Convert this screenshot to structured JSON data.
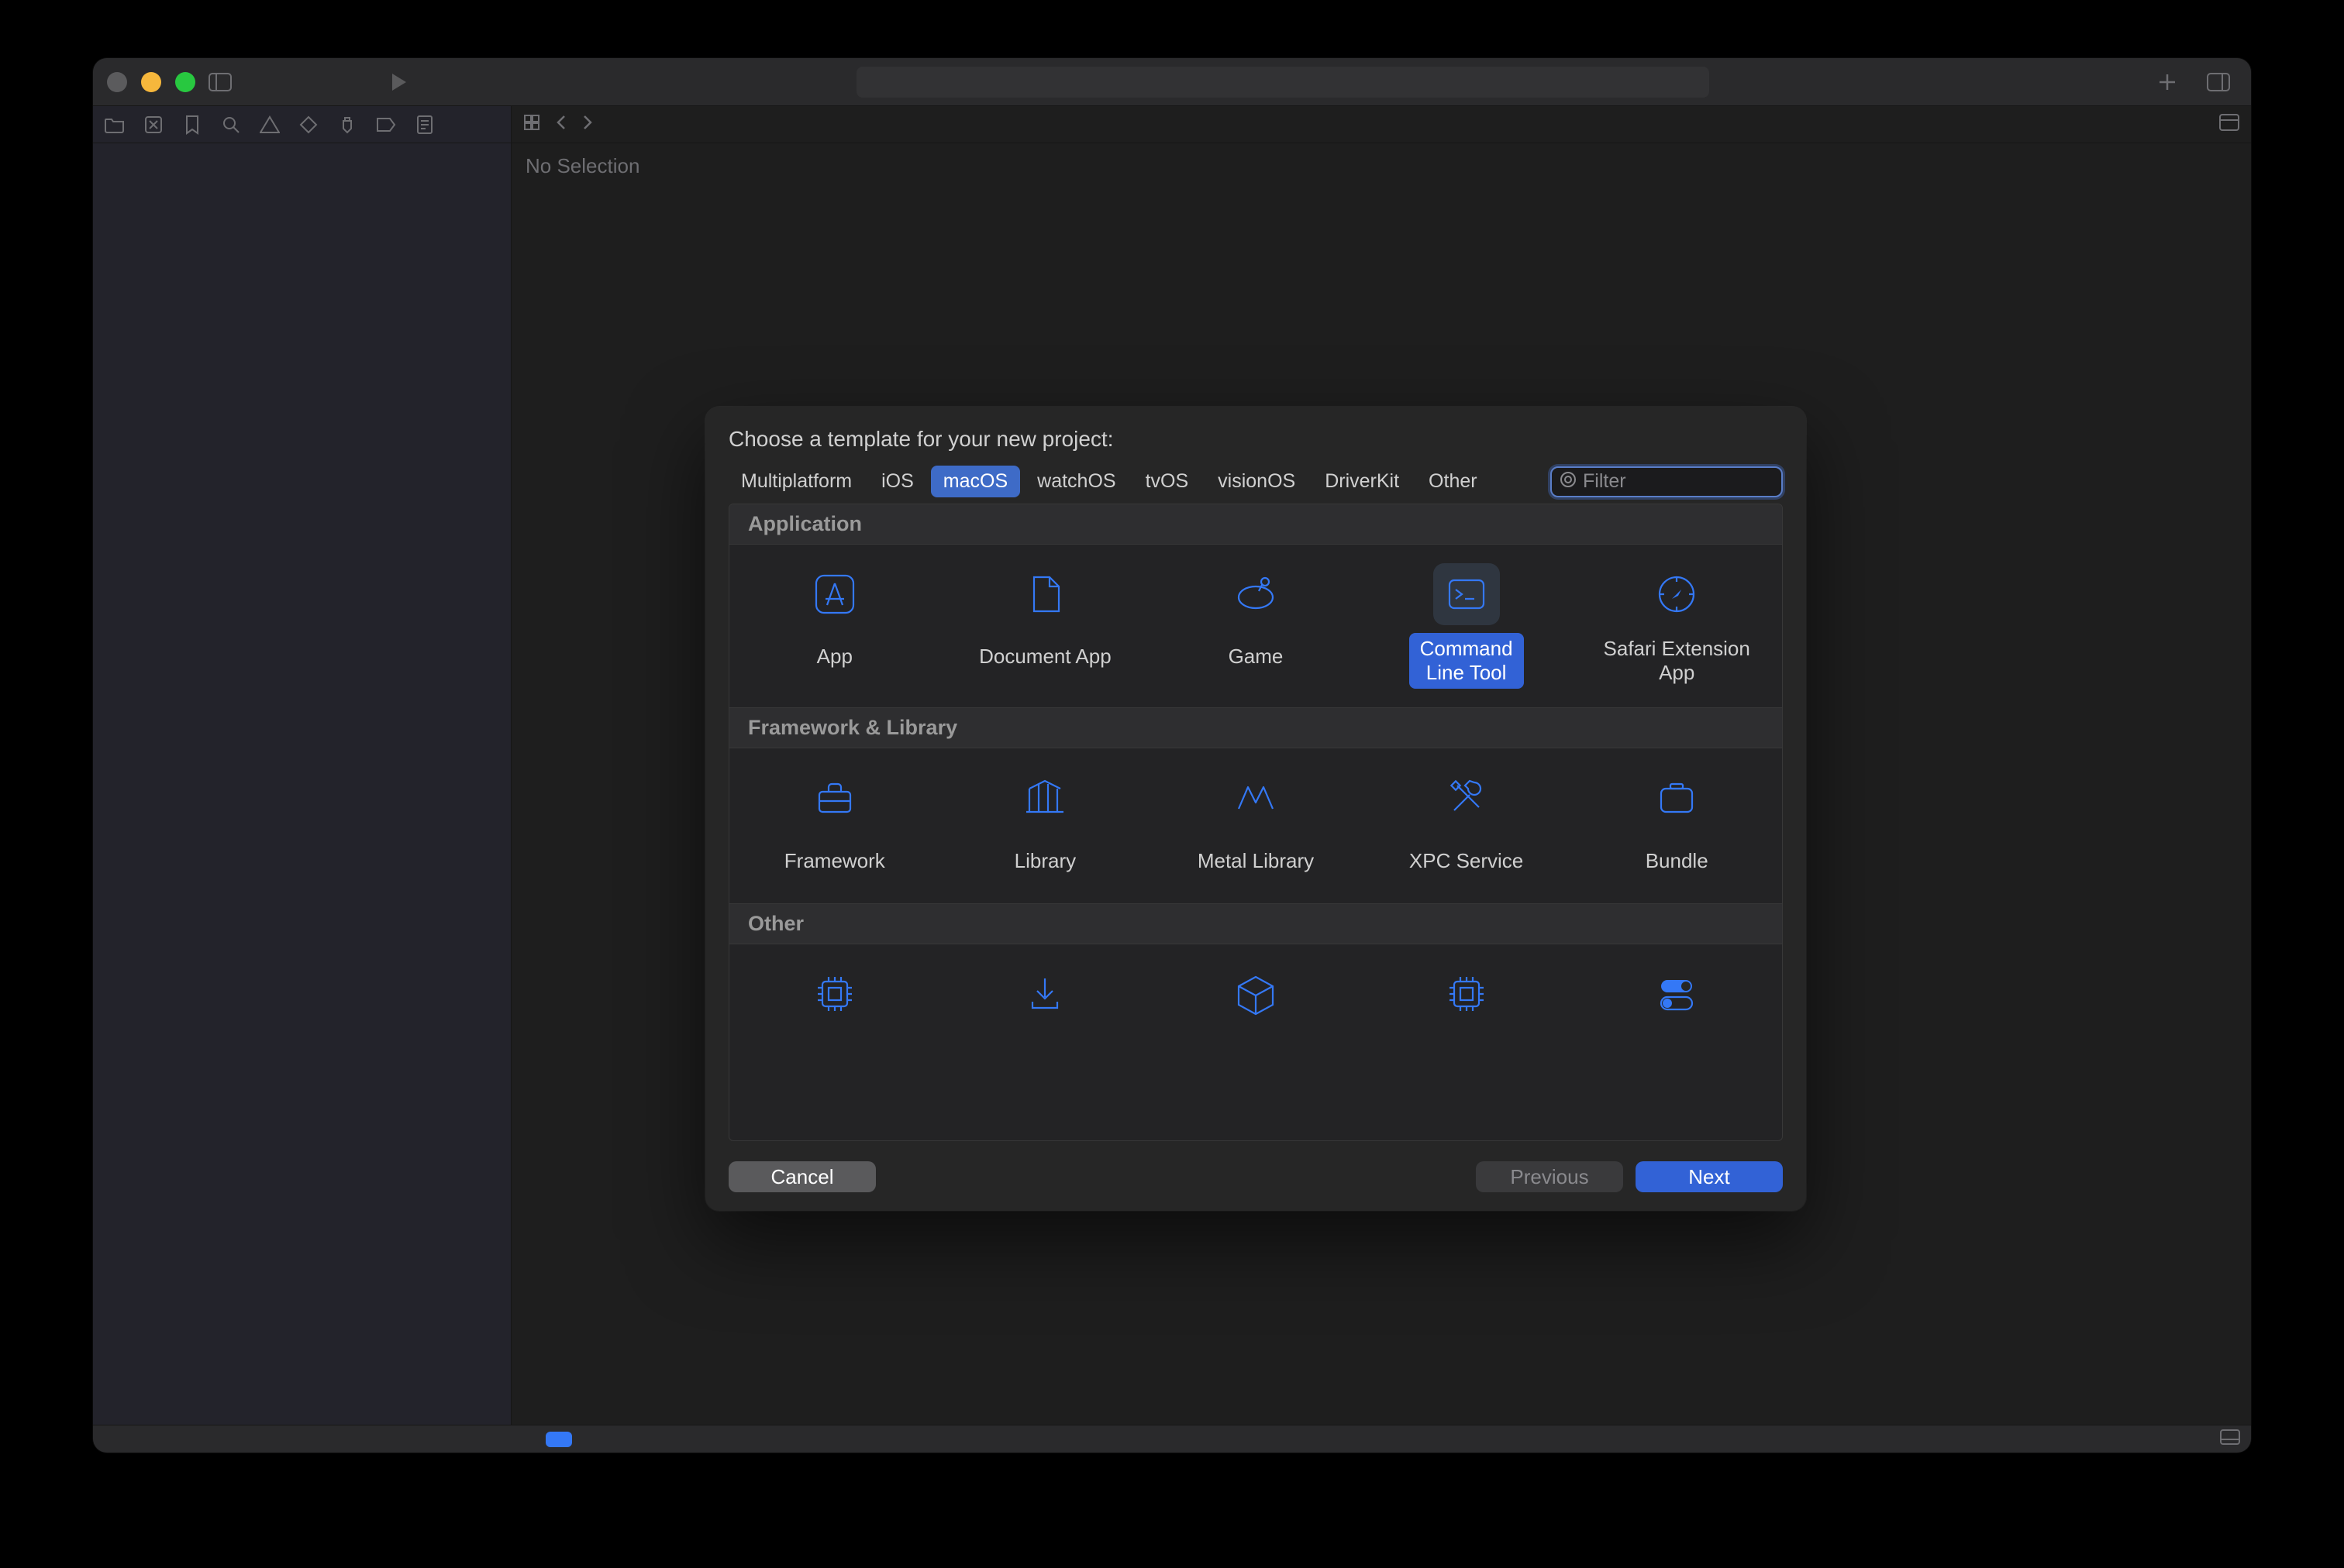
{
  "editor": {
    "no_selection": "No Selection"
  },
  "dialog": {
    "title": "Choose a template for your new project:",
    "platform_tabs": [
      {
        "label": "Multiplatform",
        "selected": false
      },
      {
        "label": "iOS",
        "selected": false
      },
      {
        "label": "macOS",
        "selected": true
      },
      {
        "label": "watchOS",
        "selected": false
      },
      {
        "label": "tvOS",
        "selected": false
      },
      {
        "label": "visionOS",
        "selected": false
      },
      {
        "label": "DriverKit",
        "selected": false
      },
      {
        "label": "Other",
        "selected": false
      }
    ],
    "filter_placeholder": "Filter",
    "sections": {
      "application": {
        "title": "Application",
        "items": [
          {
            "label": "App",
            "icon": "app-store-icon",
            "selected": false
          },
          {
            "label": "Document App",
            "icon": "document-icon",
            "selected": false
          },
          {
            "label": "Game",
            "icon": "game-icon",
            "selected": false
          },
          {
            "label": "Command\nLine Tool",
            "icon": "terminal-icon",
            "selected": true
          },
          {
            "label": "Safari Extension\nApp",
            "icon": "compass-icon",
            "selected": false
          }
        ]
      },
      "framework": {
        "title": "Framework & Library",
        "items": [
          {
            "label": "Framework",
            "icon": "toolbox-icon",
            "selected": false
          },
          {
            "label": "Library",
            "icon": "columns-icon",
            "selected": false
          },
          {
            "label": "Metal Library",
            "icon": "metal-icon",
            "selected": false
          },
          {
            "label": "XPC Service",
            "icon": "tools-icon",
            "selected": false
          },
          {
            "label": "Bundle",
            "icon": "battery-icon",
            "selected": false
          }
        ]
      },
      "other": {
        "title": "Other",
        "items": [
          {
            "label": "",
            "icon": "chip-icon",
            "selected": false
          },
          {
            "label": "",
            "icon": "download-icon",
            "selected": false
          },
          {
            "label": "",
            "icon": "cube-icon",
            "selected": false
          },
          {
            "label": "",
            "icon": "chip-icon",
            "selected": false
          },
          {
            "label": "",
            "icon": "toggles-icon",
            "selected": false
          }
        ]
      }
    },
    "buttons": {
      "cancel": "Cancel",
      "previous": "Previous",
      "next": "Next"
    }
  }
}
